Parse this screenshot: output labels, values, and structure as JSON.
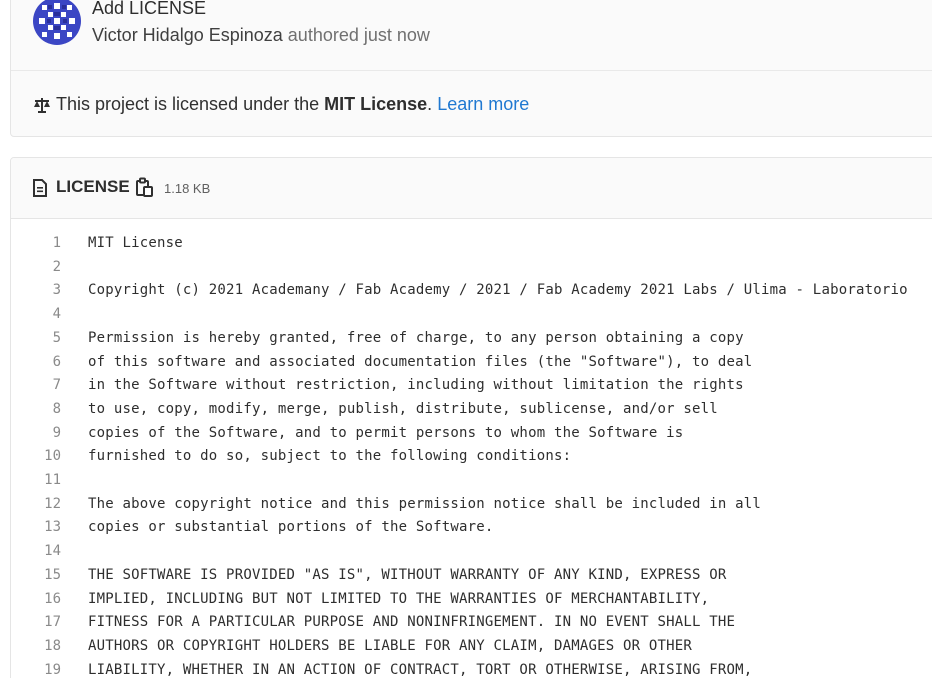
{
  "commit": {
    "title": "Add LICENSE",
    "author": "Victor Hidalgo Espinoza",
    "time": "authored just now"
  },
  "license_notice": {
    "prefix": "This project is licensed under the ",
    "license_name": "MIT License",
    "suffix": ". ",
    "link": "Learn more"
  },
  "file": {
    "name": "LICENSE",
    "size": "1.18 KB"
  },
  "lines": [
    {
      "num": "1",
      "text": "MIT License"
    },
    {
      "num": "2",
      "text": ""
    },
    {
      "num": "3",
      "text": "Copyright (c) 2021 Academany / Fab Academy / 2021 / Fab Academy 2021 Labs / Ulima - Laboratorio"
    },
    {
      "num": "4",
      "text": ""
    },
    {
      "num": "5",
      "text": "Permission is hereby granted, free of charge, to any person obtaining a copy"
    },
    {
      "num": "6",
      "text": "of this software and associated documentation files (the \"Software\"), to deal"
    },
    {
      "num": "7",
      "text": "in the Software without restriction, including without limitation the rights"
    },
    {
      "num": "8",
      "text": "to use, copy, modify, merge, publish, distribute, sublicense, and/or sell"
    },
    {
      "num": "9",
      "text": "copies of the Software, and to permit persons to whom the Software is"
    },
    {
      "num": "10",
      "text": "furnished to do so, subject to the following conditions:"
    },
    {
      "num": "11",
      "text": ""
    },
    {
      "num": "12",
      "text": "The above copyright notice and this permission notice shall be included in all"
    },
    {
      "num": "13",
      "text": "copies or substantial portions of the Software."
    },
    {
      "num": "14",
      "text": ""
    },
    {
      "num": "15",
      "text": "THE SOFTWARE IS PROVIDED \"AS IS\", WITHOUT WARRANTY OF ANY KIND, EXPRESS OR"
    },
    {
      "num": "16",
      "text": "IMPLIED, INCLUDING BUT NOT LIMITED TO THE WARRANTIES OF MERCHANTABILITY,"
    },
    {
      "num": "17",
      "text": "FITNESS FOR A PARTICULAR PURPOSE AND NONINFRINGEMENT. IN NO EVENT SHALL THE"
    },
    {
      "num": "18",
      "text": "AUTHORS OR COPYRIGHT HOLDERS BE LIABLE FOR ANY CLAIM, DAMAGES OR OTHER"
    },
    {
      "num": "19",
      "text": "LIABILITY, WHETHER IN AN ACTION OF CONTRACT, TORT OR OTHERWISE, ARISING FROM,"
    }
  ],
  "icons": {
    "avatar": "identicon-avatar",
    "license": "scale-icon",
    "file": "file-icon",
    "copy": "copy-icon"
  },
  "colors": {
    "link": "#1f78d1",
    "avatar": "#3b46c4"
  }
}
